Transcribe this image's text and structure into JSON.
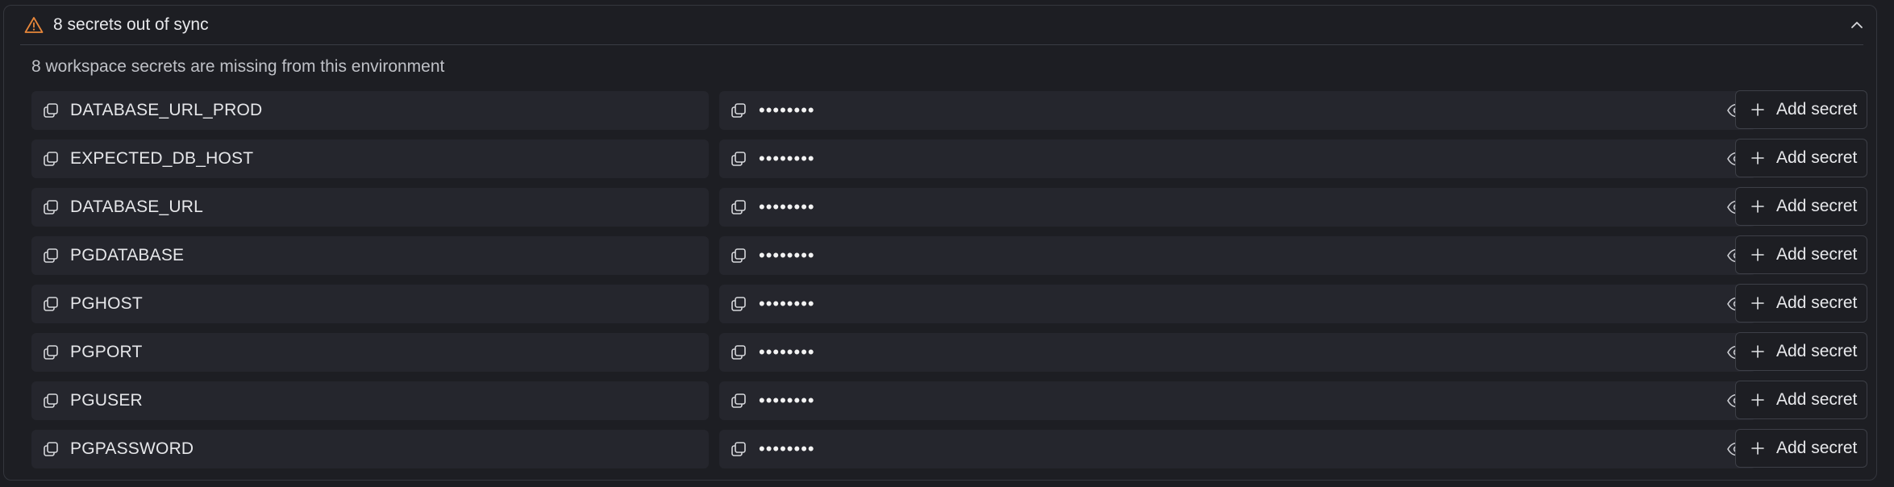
{
  "header": {
    "title": "8 secrets out of sync",
    "warning_color": "#e8873a",
    "icon": "warning-triangle-icon",
    "collapse_icon": "chevron-up-icon"
  },
  "subtitle": "8 workspace secrets are missing from this environment",
  "secrets": [
    {
      "key": "DATABASE_URL_PROD",
      "value": "••••••••",
      "action": "Add secret"
    },
    {
      "key": "EXPECTED_DB_HOST",
      "value": "••••••••",
      "action": "Add secret"
    },
    {
      "key": "DATABASE_URL",
      "value": "••••••••",
      "action": "Add secret"
    },
    {
      "key": "PGDATABASE",
      "value": "••••••••",
      "action": "Add secret"
    },
    {
      "key": "PGHOST",
      "value": "••••••••",
      "action": "Add secret"
    },
    {
      "key": "PGPORT",
      "value": "••••••••",
      "action": "Add secret"
    },
    {
      "key": "PGUSER",
      "value": "••••••••",
      "action": "Add secret"
    },
    {
      "key": "PGPASSWORD",
      "value": "••••••••",
      "action": "Add secret"
    }
  ]
}
